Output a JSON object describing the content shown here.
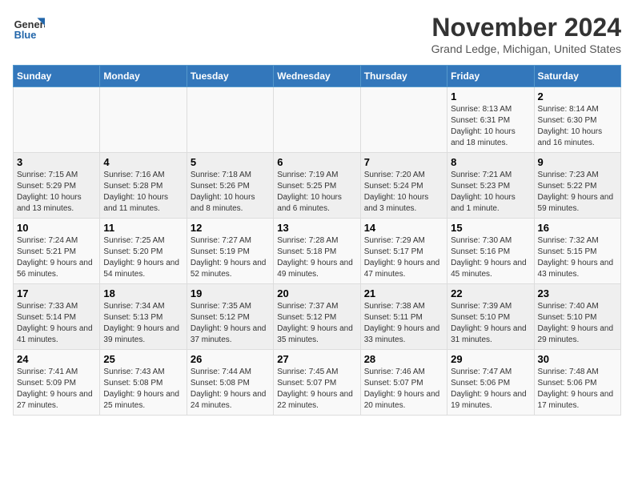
{
  "header": {
    "logo_line1": "General",
    "logo_line2": "Blue",
    "month_year": "November 2024",
    "location": "Grand Ledge, Michigan, United States"
  },
  "weekdays": [
    "Sunday",
    "Monday",
    "Tuesday",
    "Wednesday",
    "Thursday",
    "Friday",
    "Saturday"
  ],
  "weeks": [
    [
      {
        "day": "",
        "info": ""
      },
      {
        "day": "",
        "info": ""
      },
      {
        "day": "",
        "info": ""
      },
      {
        "day": "",
        "info": ""
      },
      {
        "day": "",
        "info": ""
      },
      {
        "day": "1",
        "info": "Sunrise: 8:13 AM\nSunset: 6:31 PM\nDaylight: 10 hours and 18 minutes."
      },
      {
        "day": "2",
        "info": "Sunrise: 8:14 AM\nSunset: 6:30 PM\nDaylight: 10 hours and 16 minutes."
      }
    ],
    [
      {
        "day": "3",
        "info": "Sunrise: 7:15 AM\nSunset: 5:29 PM\nDaylight: 10 hours and 13 minutes."
      },
      {
        "day": "4",
        "info": "Sunrise: 7:16 AM\nSunset: 5:28 PM\nDaylight: 10 hours and 11 minutes."
      },
      {
        "day": "5",
        "info": "Sunrise: 7:18 AM\nSunset: 5:26 PM\nDaylight: 10 hours and 8 minutes."
      },
      {
        "day": "6",
        "info": "Sunrise: 7:19 AM\nSunset: 5:25 PM\nDaylight: 10 hours and 6 minutes."
      },
      {
        "day": "7",
        "info": "Sunrise: 7:20 AM\nSunset: 5:24 PM\nDaylight: 10 hours and 3 minutes."
      },
      {
        "day": "8",
        "info": "Sunrise: 7:21 AM\nSunset: 5:23 PM\nDaylight: 10 hours and 1 minute."
      },
      {
        "day": "9",
        "info": "Sunrise: 7:23 AM\nSunset: 5:22 PM\nDaylight: 9 hours and 59 minutes."
      }
    ],
    [
      {
        "day": "10",
        "info": "Sunrise: 7:24 AM\nSunset: 5:21 PM\nDaylight: 9 hours and 56 minutes."
      },
      {
        "day": "11",
        "info": "Sunrise: 7:25 AM\nSunset: 5:20 PM\nDaylight: 9 hours and 54 minutes."
      },
      {
        "day": "12",
        "info": "Sunrise: 7:27 AM\nSunset: 5:19 PM\nDaylight: 9 hours and 52 minutes."
      },
      {
        "day": "13",
        "info": "Sunrise: 7:28 AM\nSunset: 5:18 PM\nDaylight: 9 hours and 49 minutes."
      },
      {
        "day": "14",
        "info": "Sunrise: 7:29 AM\nSunset: 5:17 PM\nDaylight: 9 hours and 47 minutes."
      },
      {
        "day": "15",
        "info": "Sunrise: 7:30 AM\nSunset: 5:16 PM\nDaylight: 9 hours and 45 minutes."
      },
      {
        "day": "16",
        "info": "Sunrise: 7:32 AM\nSunset: 5:15 PM\nDaylight: 9 hours and 43 minutes."
      }
    ],
    [
      {
        "day": "17",
        "info": "Sunrise: 7:33 AM\nSunset: 5:14 PM\nDaylight: 9 hours and 41 minutes."
      },
      {
        "day": "18",
        "info": "Sunrise: 7:34 AM\nSunset: 5:13 PM\nDaylight: 9 hours and 39 minutes."
      },
      {
        "day": "19",
        "info": "Sunrise: 7:35 AM\nSunset: 5:12 PM\nDaylight: 9 hours and 37 minutes."
      },
      {
        "day": "20",
        "info": "Sunrise: 7:37 AM\nSunset: 5:12 PM\nDaylight: 9 hours and 35 minutes."
      },
      {
        "day": "21",
        "info": "Sunrise: 7:38 AM\nSunset: 5:11 PM\nDaylight: 9 hours and 33 minutes."
      },
      {
        "day": "22",
        "info": "Sunrise: 7:39 AM\nSunset: 5:10 PM\nDaylight: 9 hours and 31 minutes."
      },
      {
        "day": "23",
        "info": "Sunrise: 7:40 AM\nSunset: 5:10 PM\nDaylight: 9 hours and 29 minutes."
      }
    ],
    [
      {
        "day": "24",
        "info": "Sunrise: 7:41 AM\nSunset: 5:09 PM\nDaylight: 9 hours and 27 minutes."
      },
      {
        "day": "25",
        "info": "Sunrise: 7:43 AM\nSunset: 5:08 PM\nDaylight: 9 hours and 25 minutes."
      },
      {
        "day": "26",
        "info": "Sunrise: 7:44 AM\nSunset: 5:08 PM\nDaylight: 9 hours and 24 minutes."
      },
      {
        "day": "27",
        "info": "Sunrise: 7:45 AM\nSunset: 5:07 PM\nDaylight: 9 hours and 22 minutes."
      },
      {
        "day": "28",
        "info": "Sunrise: 7:46 AM\nSunset: 5:07 PM\nDaylight: 9 hours and 20 minutes."
      },
      {
        "day": "29",
        "info": "Sunrise: 7:47 AM\nSunset: 5:06 PM\nDaylight: 9 hours and 19 minutes."
      },
      {
        "day": "30",
        "info": "Sunrise: 7:48 AM\nSunset: 5:06 PM\nDaylight: 9 hours and 17 minutes."
      }
    ]
  ]
}
